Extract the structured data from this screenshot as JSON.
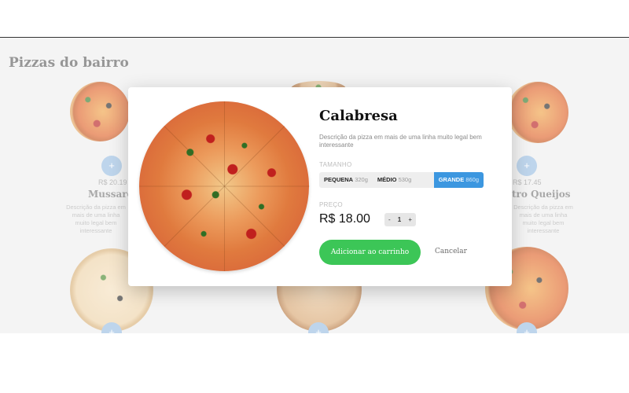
{
  "page": {
    "title": "Pizzas do bairro"
  },
  "background_cards": [
    {
      "price": "R$ 20.19",
      "name": "Mussare",
      "description": "Descrição da pizza em mais de uma linha muito legal bem interessante",
      "add": "+"
    },
    {
      "price": "R$ 17.45",
      "name": "tro Queijos",
      "description": "Descrição da pizza em mais de uma linha muito legal bem interessante",
      "add": "+"
    },
    {
      "add": "+"
    },
    {
      "add": "+"
    },
    {
      "add": "+"
    }
  ],
  "modal": {
    "title": "Calabresa",
    "description": "Descrição da pizza em mais de uma linha muito legal bem interessante",
    "size_label": "TAMANHO",
    "sizes": [
      {
        "name": "PEQUENA",
        "weight": "320g"
      },
      {
        "name": "MÉDIO",
        "weight": "530g"
      },
      {
        "name": "GRANDE",
        "weight": "860g"
      }
    ],
    "selected_size": "GRANDE",
    "price_label": "PREÇO",
    "price": "R$ 18.00",
    "quantity": {
      "minus": "-",
      "value": "1",
      "plus": "+"
    },
    "add_button": "Adicionar ao carrinho",
    "cancel_button": "Cancelar"
  },
  "colors": {
    "accent": "#3c97e0",
    "add_button": "#3cc657",
    "plus_button": "#9bbfe2"
  }
}
